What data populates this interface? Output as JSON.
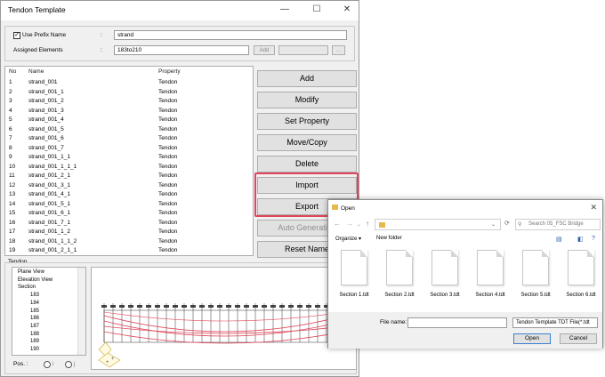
{
  "window": {
    "title": "Tendon Template",
    "min": "—",
    "max": "☐",
    "close": "✕"
  },
  "prefix": {
    "checkbox_label": "Use Prefix Name",
    "checked": "✓",
    "colon": ":",
    "value": "strand"
  },
  "assigned": {
    "label": "Assigned Elements",
    "colon": ":",
    "value": "183to210",
    "add_label": "Add",
    "more_label": "..."
  },
  "list": {
    "headers": [
      "No",
      "Name",
      "Property"
    ],
    "rows": [
      [
        "1",
        "strand_001",
        "Tendon"
      ],
      [
        "2",
        "strand_001_1",
        "Tendon"
      ],
      [
        "3",
        "strand_001_2",
        "Tendon"
      ],
      [
        "4",
        "strand_001_3",
        "Tendon"
      ],
      [
        "5",
        "strand_001_4",
        "Tendon"
      ],
      [
        "6",
        "strand_001_5",
        "Tendon"
      ],
      [
        "7",
        "strand_001_6",
        "Tendon"
      ],
      [
        "8",
        "strand_001_7",
        "Tendon"
      ],
      [
        "9",
        "strand_001_1_1",
        "Tendon"
      ],
      [
        "10",
        "strand_001_1_1_1",
        "Tendon"
      ],
      [
        "11",
        "strand_001_2_1",
        "Tendon"
      ],
      [
        "12",
        "strand_001_3_1",
        "Tendon"
      ],
      [
        "13",
        "strand_001_4_1",
        "Tendon"
      ],
      [
        "14",
        "strand_001_5_1",
        "Tendon"
      ],
      [
        "15",
        "strand_001_6_1",
        "Tendon"
      ],
      [
        "16",
        "strand_001_7_1",
        "Tendon"
      ],
      [
        "17",
        "strand_001_1_2",
        "Tendon"
      ],
      [
        "18",
        "strand_001_1_1_2",
        "Tendon"
      ],
      [
        "19",
        "strand_001_2_1_1",
        "Tendon"
      ]
    ]
  },
  "buttons": [
    "Add",
    "Modify",
    "Set Property",
    "Move/Copy",
    "Delete",
    "Import",
    "Export",
    "Auto Generation",
    "Reset Name"
  ],
  "highlight_color": "#e0475a",
  "tendon": {
    "label": "Tendon",
    "tree": [
      "Plane View",
      "Elevation View",
      "Section",
      "183",
      "184",
      "185",
      "186",
      "187",
      "188",
      "189",
      "190"
    ],
    "pos_label": "Pos. :",
    "pos_options": [
      "i",
      "j"
    ]
  },
  "dialog": {
    "title": "Open",
    "close": "✕",
    "search_placeholder": "Search 05_FSC Bridge",
    "organize": "Organize ▾",
    "new_folder": "New folder",
    "files": [
      "Section 1.tdt",
      "Section 2.tdt",
      "Section 3.tdt",
      "Section 4.tdt",
      "Section 5.tdt",
      "Section 6.tdt"
    ],
    "filename_label": "File name:",
    "filetype": "Tendon Template TDT File(*.tdt",
    "open_label": "Open",
    "cancel_label": "Cancel"
  }
}
